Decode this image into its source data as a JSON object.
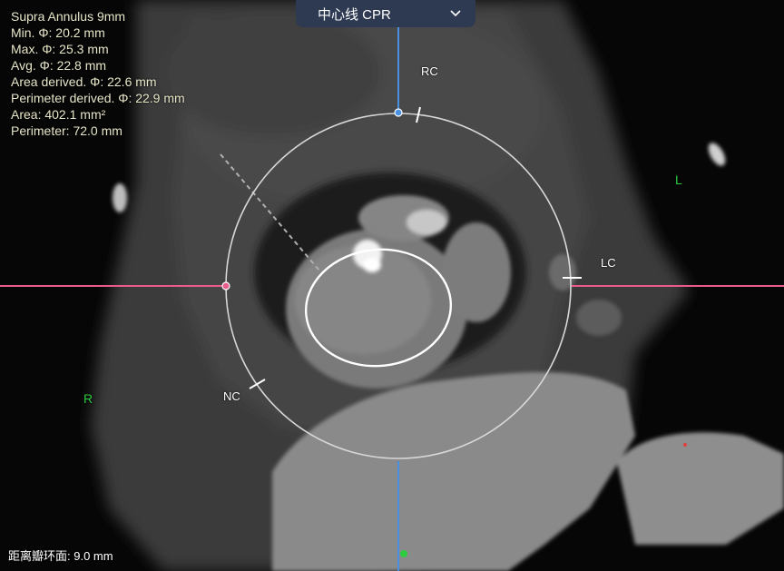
{
  "view_selector": {
    "label": "中心线 CPR",
    "icon": "chevron-down-icon"
  },
  "measurement": {
    "title": "Supra Annulus 9mm",
    "lines": [
      "Min. Φ: 20.2 mm",
      "Max. Φ: 25.3 mm",
      "Avg. Φ: 22.8 mm",
      "Area derived. Φ: 22.6 mm",
      "Perimeter derived. Φ: 22.9 mm",
      "Area: 402.1 mm²",
      "Perimeter: 72.0 mm"
    ]
  },
  "cusps": {
    "rc": "RC",
    "lc": "LC",
    "nc": "NC"
  },
  "orientation": {
    "left": "L",
    "right": "R"
  },
  "footer": {
    "distance": "距离瓣环面: 9.0 mm"
  },
  "colors": {
    "crosshair_vertical": "#4a90e2",
    "crosshair_horizontal": "#e85c8a",
    "orientation": "#2ecc40",
    "view_selector_bg": "#2d3a52",
    "text": "#e8e6c8"
  }
}
